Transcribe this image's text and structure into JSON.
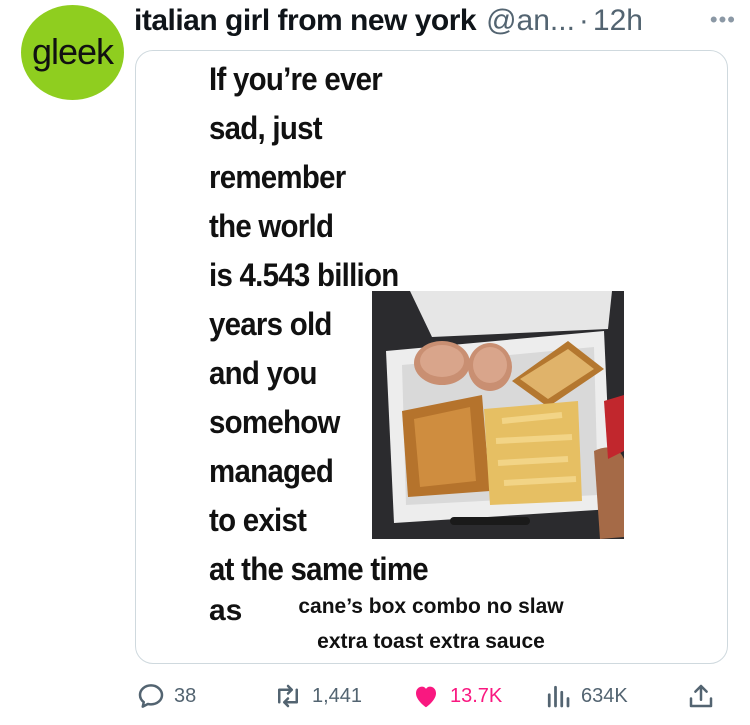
{
  "tweet": {
    "avatar_text": "gleek",
    "author_name": "italian girl from new york",
    "handle": "@an...",
    "separator": "·",
    "time": "12h",
    "more_glyph": "•••"
  },
  "media": {
    "text_lines": [
      "If you’re ever",
      "sad, just",
      "remember",
      "the world",
      "is 4.543 billion",
      "years old",
      "and you",
      "somehow",
      "managed",
      "to exist",
      "at the same time"
    ],
    "as_word": "as",
    "combo_line1": "cane’s box combo no slaw",
    "combo_line2": "extra toast extra sauce"
  },
  "actions": {
    "replies": "38",
    "reposts": "1,441",
    "likes": "13.7K",
    "views": "634K"
  },
  "colors": {
    "avatar": "#8fce1f",
    "like": "#f91880",
    "muted": "#536471"
  }
}
